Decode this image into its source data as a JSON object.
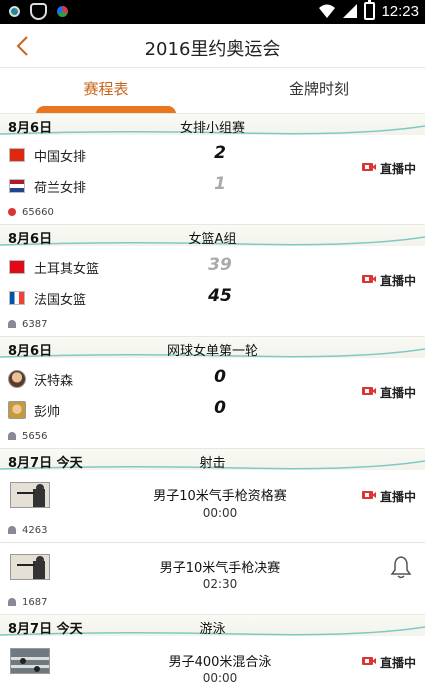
{
  "status_bar": {
    "time": "12:23"
  },
  "header": {
    "title": "2016里约奥运会"
  },
  "tabs": [
    {
      "label": "赛程表",
      "active": true
    },
    {
      "label": "金牌时刻",
      "active": false
    }
  ],
  "live_label": "直播中",
  "sections": [
    {
      "date": "8月6日",
      "title": "女排小组赛",
      "teams": [
        {
          "name": "中国女排",
          "score": "2"
        },
        {
          "name": "荷兰女排",
          "score": "1"
        }
      ],
      "viewers": "65660"
    },
    {
      "date": "8月6日",
      "title": "女篮A组",
      "teams": [
        {
          "name": "土耳其女篮",
          "score": "39"
        },
        {
          "name": "法国女篮",
          "score": "45"
        }
      ],
      "viewers": "6387"
    },
    {
      "date": "8月6日",
      "title": "网球女单第一轮",
      "teams": [
        {
          "name": "沃特森",
          "score": "0"
        },
        {
          "name": "彭帅",
          "score": "0"
        }
      ],
      "viewers": "5656"
    },
    {
      "date": "8月7日 今天",
      "title": "射击",
      "events": [
        {
          "title": "男子10米气手枪资格赛",
          "time": "00:00",
          "viewers": "4263"
        },
        {
          "title": "男子10米气手枪决赛",
          "time": "02:30",
          "viewers": "1687"
        }
      ]
    },
    {
      "date": "8月7日 今天",
      "title": "游泳",
      "events": [
        {
          "title": "男子400米混合泳",
          "time": "00:00"
        }
      ]
    }
  ]
}
